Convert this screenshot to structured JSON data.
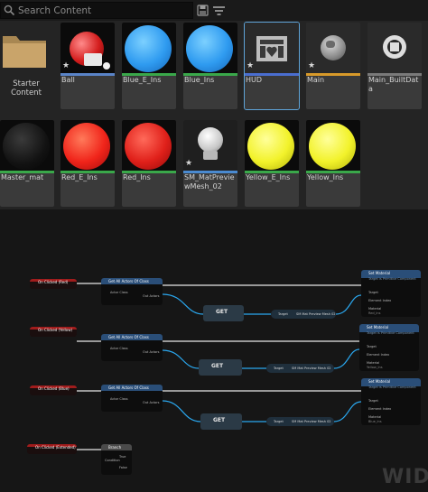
{
  "search": {
    "placeholder": "Search Content"
  },
  "toolbar": {
    "save_icon": "save-icon",
    "filter_icon": "filter-icon"
  },
  "folder": {
    "label": "Starter Content"
  },
  "assets_row1": [
    {
      "label": "Ball",
      "bar_color": "#5a84c8"
    },
    {
      "label": "Blue_E_Ins",
      "bar_color": "#3aa84a"
    },
    {
      "label": "Blue_Ins",
      "bar_color": "#3aa84a"
    },
    {
      "label": "HUD",
      "bar_color": "#4a6ed0"
    },
    {
      "label": "Main",
      "bar_color": "#d89a2a"
    },
    {
      "label": "Main_BuiltData",
      "bar_color": "#7a7a7a"
    }
  ],
  "assets_row2": [
    {
      "label": "Master_mat",
      "bar_color": "#3aa84a"
    },
    {
      "label": "Red_E_Ins",
      "bar_color": "#3aa84a"
    },
    {
      "label": "Red_Ins",
      "bar_color": "#3aa84a"
    },
    {
      "label": "SM_MatPreviewMesh_02",
      "bar_color": "#4a8ad0"
    },
    {
      "label": "Yellow_E_Ins",
      "bar_color": "#3aa84a"
    },
    {
      "label": "Yellow_Ins",
      "bar_color": "#3aa84a"
    }
  ],
  "graph": {
    "watermark": "WIDG",
    "events": [
      "On Clicked (Red)",
      "On Clicked (Yellow)",
      "On Clicked (Blue)",
      "On Clicked (Extended)"
    ],
    "get_all_actors_title": "Get All Actors Of Class",
    "actor_class_pin": "Actor Class",
    "out_actors_pin": "Out Actors",
    "get_label": "GET",
    "target_pin": "Target",
    "preview_mesh_ref": "SM Mat Preview Mesh 02",
    "set_material_title": "Set Material",
    "set_material_subtitle": "Target is Primitive Component",
    "element_index_pin": "Element Index",
    "material_pin": "Material",
    "material_values": [
      "Red_Ins",
      "Yellow_Ins",
      "Blue_Ins"
    ],
    "branch_title": "Branch",
    "branch_pins": [
      "Condition",
      "True",
      "False"
    ],
    "element_index_value": "0"
  }
}
